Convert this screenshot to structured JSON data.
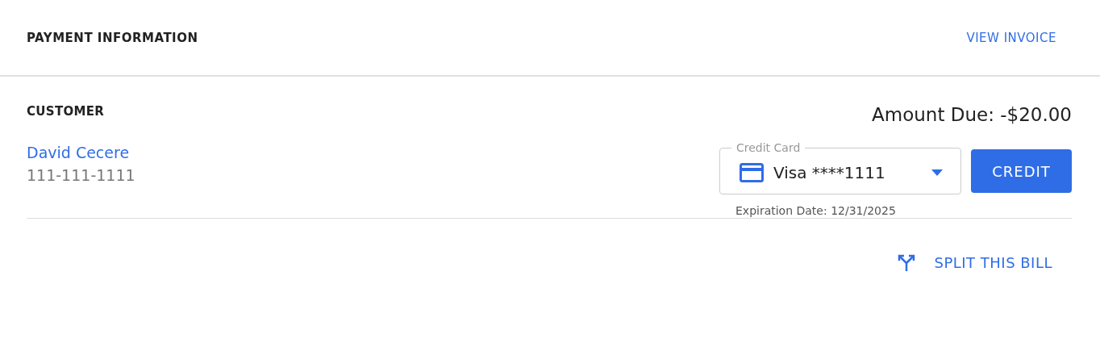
{
  "header": {
    "title": "PAYMENT INFORMATION",
    "action": "VIEW INVOICE"
  },
  "customer": {
    "heading": "CUSTOMER",
    "name": "David Cecere",
    "phone": "111-111-1111"
  },
  "amount_due": "Amount Due: -$20.00",
  "payment_method": {
    "label": "Credit Card",
    "value": "Visa ****1111",
    "expiration": "Expiration Date: 12/31/2025"
  },
  "buttons": [
    {
      "label": "CREDIT",
      "kind": "primary"
    }
  ],
  "footer_action": {
    "label": "SPLIT THIS BILL"
  }
}
